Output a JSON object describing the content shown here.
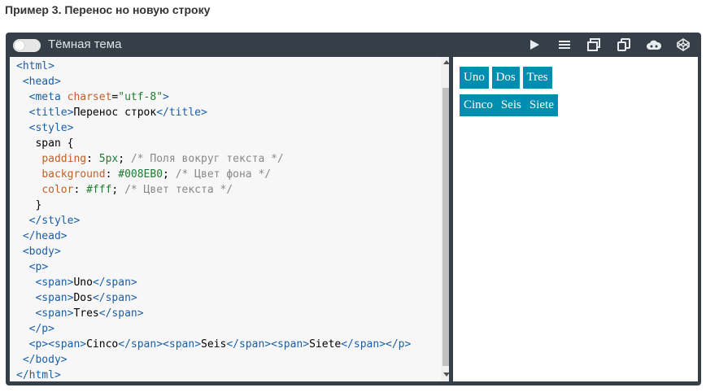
{
  "heading": "Пример 3. Перенос но новую строку",
  "toolbar": {
    "theme_label": "Тёмная тема",
    "icons": [
      "play-icon",
      "menu-icon",
      "window-icon",
      "copy-icon",
      "cloud-icon",
      "codepen-icon"
    ]
  },
  "code": {
    "lines": [
      "<html>",
      " <head>",
      "  <meta charset=\"utf-8\">",
      "  <title>Перенос строк</title>",
      "  <style>",
      "   span {",
      "    padding: 5px; /* Поля вокруг текста */",
      "    background: #008EB0; /* Цвет фона */",
      "    color: #fff; /* Цвет текста */",
      "   }",
      "  </style>",
      " </head>",
      " <body>",
      "  <p>",
      "   <span>Uno</span>",
      "   <span>Dos</span>",
      "   <span>Tres</span>",
      "  </p>",
      "  <p><span>Cinco</span><span>Seis</span><span>Siete</span></p>",
      " </body>",
      "</html>"
    ]
  },
  "preview": {
    "row1": [
      "Uno",
      "Dos",
      "Tres"
    ],
    "row2": [
      "Cinco",
      "Seis",
      "Siete"
    ],
    "chip_color": "#008EB0"
  },
  "colors": {
    "frame_bg": "#363f47",
    "editor_bg": "#f7f7f7",
    "tag": "#1a5fa8",
    "attr": "#c45f26",
    "string": "#1a7f2e",
    "comment": "#888888"
  }
}
